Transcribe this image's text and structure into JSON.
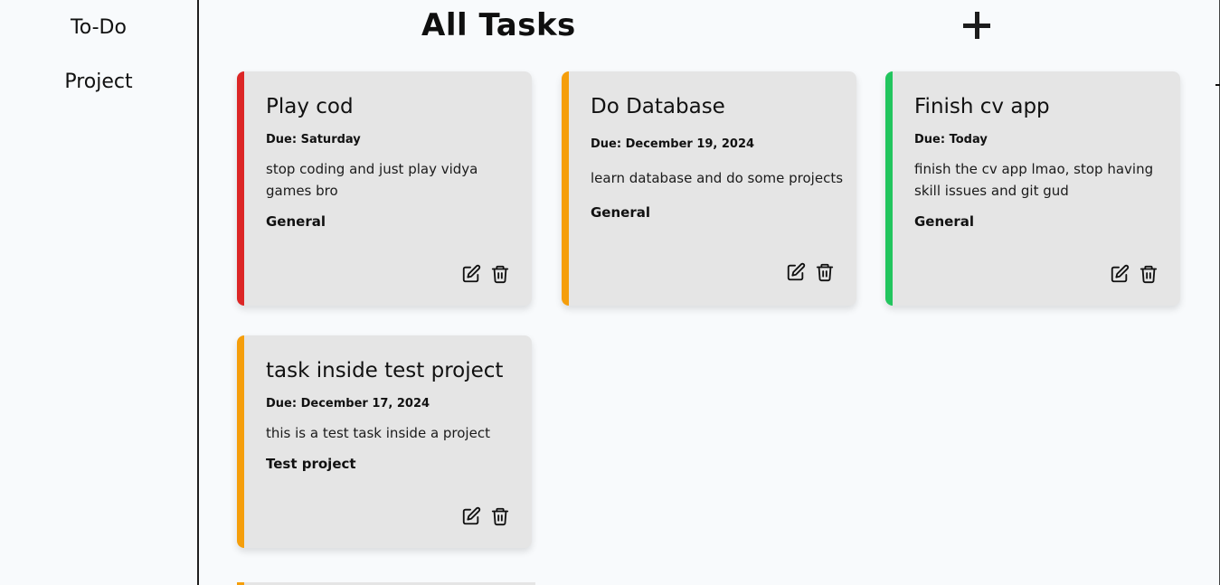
{
  "sidebar": {
    "items": [
      {
        "label": "To-Do"
      },
      {
        "label": "Project"
      }
    ]
  },
  "main": {
    "title": "All Tasks",
    "add_icon": "plus-icon"
  },
  "tasks": [
    {
      "title": "Play cod",
      "due": "Due: Saturday",
      "description": "stop coding and just play vidya games bro",
      "project": "General",
      "priority_color": "#dc2626"
    },
    {
      "title": "Do Database",
      "due": "Due: December 19, 2024",
      "description": "learn database and do some projects",
      "project": "General",
      "priority_color": "#f59e0b"
    },
    {
      "title": "Finish cv app",
      "due": "Due: Today",
      "description": "finish the cv app lmao, stop having skill issues and git gud",
      "project": "General",
      "priority_color": "#22c55e"
    },
    {
      "title": "task inside test project",
      "due": "Due: December 17, 2024",
      "description": "this is a test task inside a project",
      "project": "Test project",
      "priority_color": "#f59e0b"
    }
  ],
  "icons": {
    "edit": "edit-icon",
    "delete": "trash-icon"
  }
}
